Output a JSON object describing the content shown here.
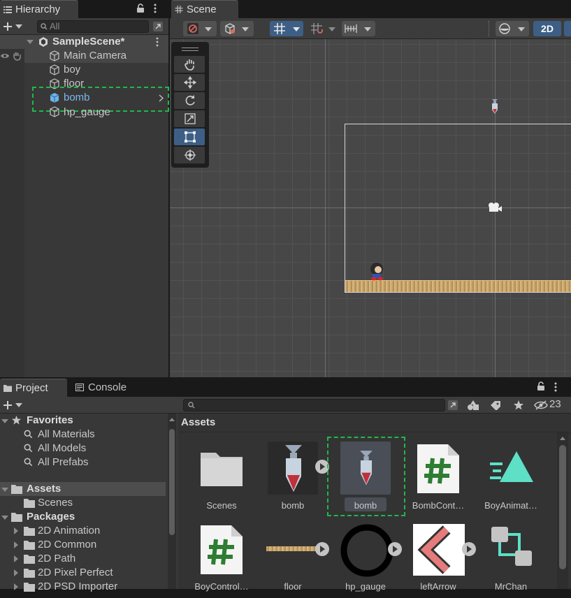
{
  "hierarchy": {
    "tab_label": "Hierarchy",
    "search_placeholder": "All",
    "scene_name": "SampleScene*",
    "items": [
      {
        "label": "Main Camera"
      },
      {
        "label": "boy"
      },
      {
        "label": "floor"
      },
      {
        "label": "bomb"
      },
      {
        "label": "hp_gauge"
      }
    ]
  },
  "scene": {
    "tab_label": "Scene",
    "mode_2d_label": "2D"
  },
  "project": {
    "tab_label": "Project",
    "console_label": "Console",
    "hidden_count": "23",
    "breadcrumb": "Assets",
    "favorites_label": "Favorites",
    "favorites": [
      "All Materials",
      "All Models",
      "All Prefabs"
    ],
    "assets_label": "Assets",
    "assets_children": [
      "Scenes"
    ],
    "packages_label": "Packages",
    "packages": [
      "2D Animation",
      "2D Common",
      "2D Path",
      "2D Pixel Perfect",
      "2D PSD Importer"
    ],
    "grid": [
      {
        "label": "Scenes",
        "icon": "folder-icon"
      },
      {
        "label": "bomb",
        "icon": "bomb-prefab-icon"
      },
      {
        "label": "bomb",
        "icon": "bomb-sprite-icon"
      },
      {
        "label": "BombCont…",
        "icon": "csharp-script-icon"
      },
      {
        "label": "BoyAnimat…",
        "icon": "animation-icon"
      },
      {
        "label": "BoyControl…",
        "icon": "csharp-script-icon"
      },
      {
        "label": "floor",
        "icon": "floor-sprite-icon"
      },
      {
        "label": "hp_gauge",
        "icon": "ring-sprite-icon"
      },
      {
        "label": "leftArrow",
        "icon": "arrow-sprite-icon"
      },
      {
        "label": "MrChan",
        "icon": "animator-controller-icon"
      }
    ]
  },
  "colors": {
    "accent_blue": "#3d5f86",
    "selection_green": "#1fb84a",
    "csharp_green": "#2e7d32",
    "anim_teal": "#5de0c6"
  }
}
